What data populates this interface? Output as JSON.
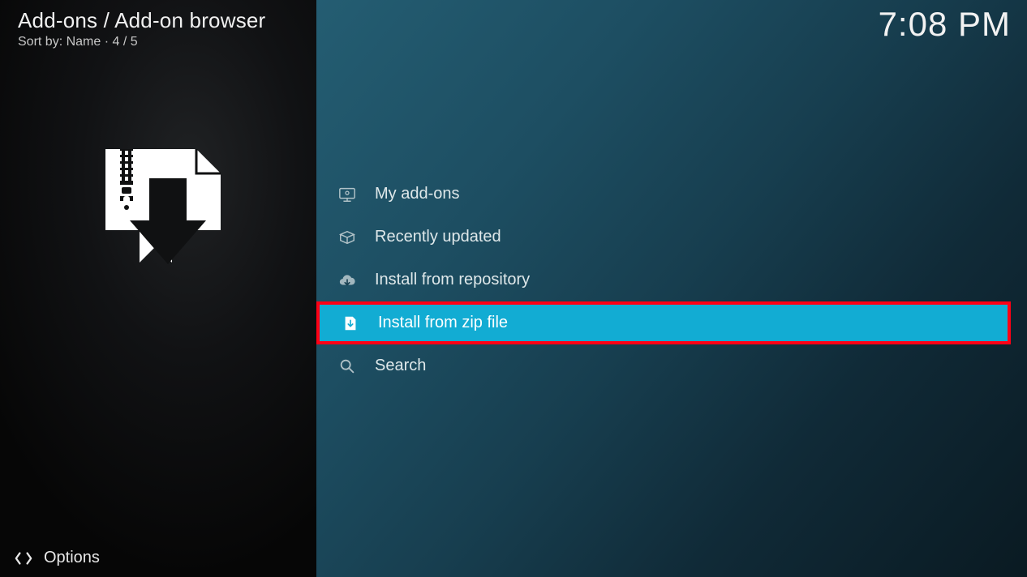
{
  "header": {
    "breadcrumb": "Add-ons / Add-on browser",
    "sort_label": "Sort by: Name  ·  4 / 5"
  },
  "clock": "7:08 PM",
  "menu": {
    "items": [
      {
        "icon": "monitor",
        "label": "My add-ons",
        "selected": false
      },
      {
        "icon": "box",
        "label": "Recently updated",
        "selected": false
      },
      {
        "icon": "cloud-down",
        "label": "Install from repository",
        "selected": false
      },
      {
        "icon": "zip-down",
        "label": "Install from zip file",
        "selected": true
      },
      {
        "icon": "search",
        "label": "Search",
        "selected": false
      }
    ]
  },
  "footer": {
    "options_label": "Options"
  }
}
